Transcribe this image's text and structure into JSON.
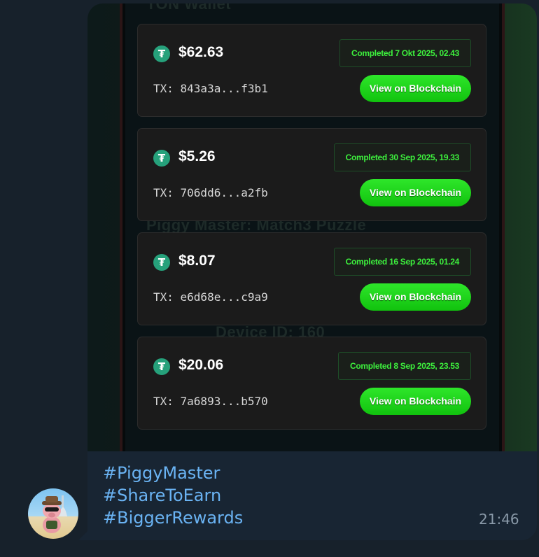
{
  "message": {
    "photo": {
      "background_labels": [
        "TON Wallet",
        "Piggy Master: Match3 Puzzle",
        "Device ID: 160"
      ],
      "transactions": [
        {
          "amount": "$62.63",
          "status": "Completed 7 Okt 2025, 02.43",
          "tx": "TX: 843a3a...f3b1",
          "button_label": "View on Blockchain"
        },
        {
          "amount": "$5.26",
          "status": "Completed 30 Sep 2025, 19.33",
          "tx": "TX: 706dd6...a2fb",
          "button_label": "View on Blockchain"
        },
        {
          "amount": "$8.07",
          "status": "Completed 16 Sep 2025, 01.24",
          "tx": "TX: e6d68e...c9a9",
          "button_label": "View on Blockchain"
        },
        {
          "amount": "$20.06",
          "status": "Completed 8 Sep 2025, 23.53",
          "tx": "TX: 7a6893...b570",
          "button_label": "View on Blockchain"
        }
      ],
      "coin_icon": "usdt-tether-icon"
    },
    "caption": {
      "hashtags": [
        "#PiggyMaster",
        "#ShareToEarn",
        "#BiggerRewards"
      ]
    },
    "time": "21:46"
  },
  "colors": {
    "chat_background": "#17212b",
    "bubble": "#182533",
    "hashtag": "#6ab3f3",
    "status_green": "#3df03d",
    "button_green": "#11c20e",
    "tether": "#26a17b"
  }
}
